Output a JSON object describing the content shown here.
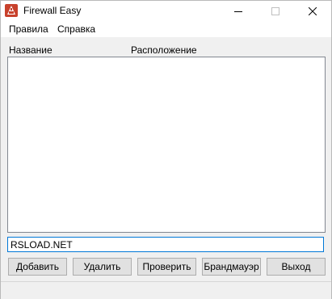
{
  "window": {
    "title": "Firewall Easy",
    "app_icon": "firewall-app-icon",
    "controls": {
      "minimize_icon": "minimize-icon",
      "maximize_icon": "maximize-icon",
      "close_icon": "close-icon"
    }
  },
  "menu": {
    "items": [
      {
        "label": "Правила"
      },
      {
        "label": "Справка"
      }
    ]
  },
  "list": {
    "columns": [
      {
        "label": "Название"
      },
      {
        "label": "Расположение"
      }
    ],
    "rows": []
  },
  "input": {
    "value": "RSLOAD.NET"
  },
  "buttons": {
    "add": "Добавить",
    "delete": "Удалить",
    "check": "Проверить",
    "firewall": "Брандмауэр",
    "exit": "Выход"
  },
  "colors": {
    "accent": "#0078d7",
    "icon_red": "#c8412c"
  }
}
